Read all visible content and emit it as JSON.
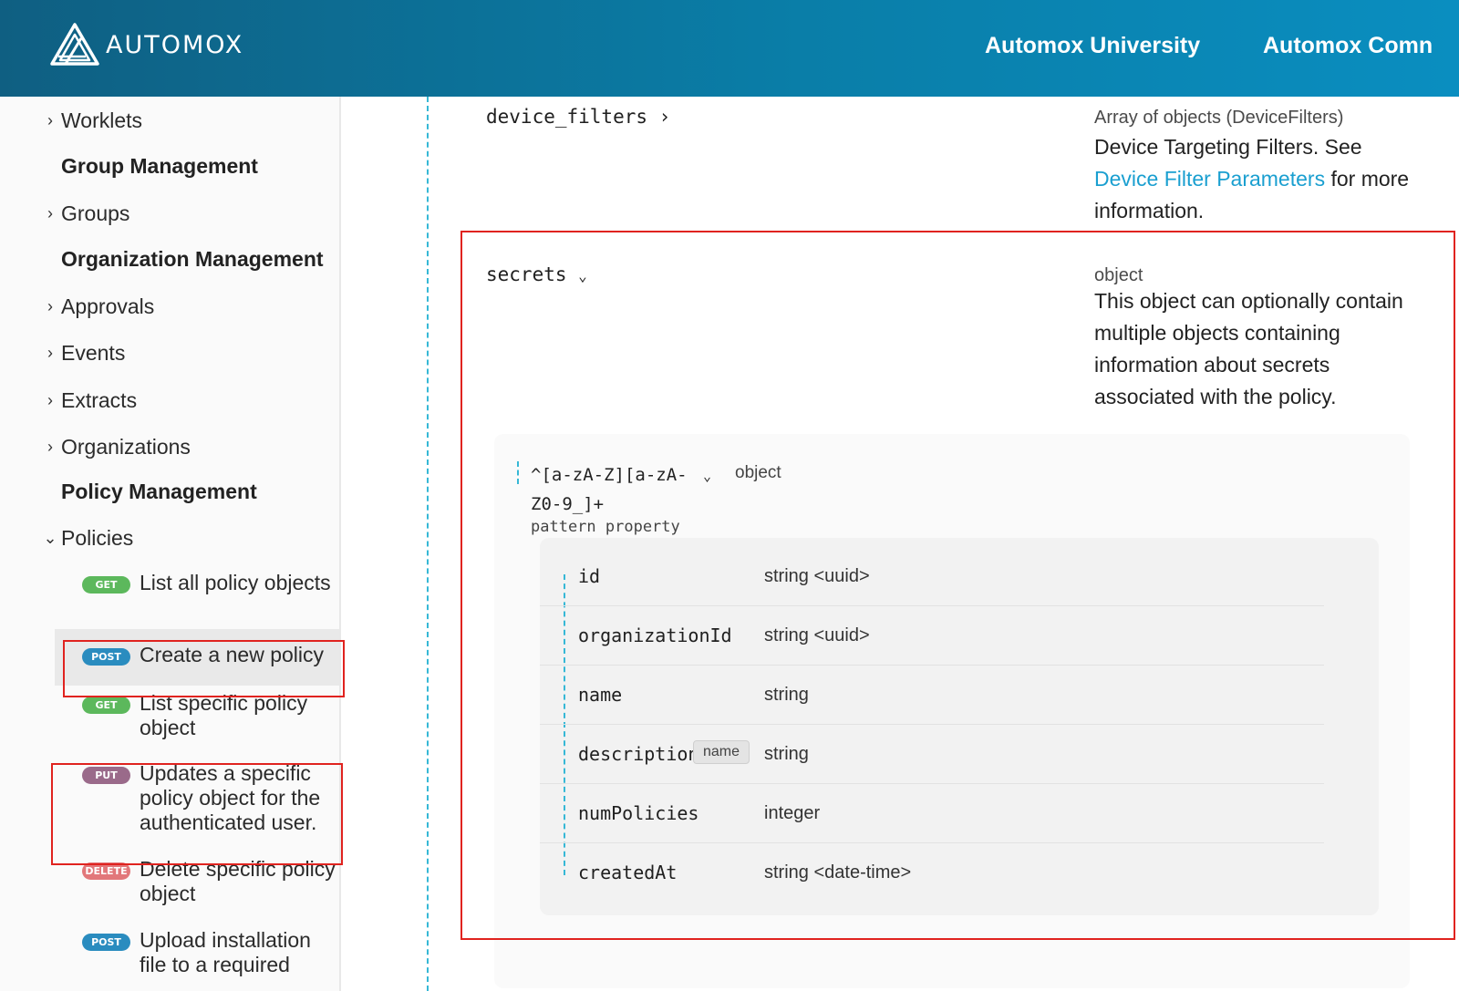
{
  "header": {
    "logo_text": "AUTOMOX",
    "nav": [
      "Automox University",
      "Automox Comn"
    ]
  },
  "sidebar": {
    "items": [
      {
        "label": "Worklets",
        "chevron": "›"
      },
      {
        "section": "Group Management"
      },
      {
        "label": "Groups",
        "chevron": "›"
      },
      {
        "section": "Organization Management"
      },
      {
        "label": "Approvals",
        "chevron": "›"
      },
      {
        "label": "Events",
        "chevron": "›"
      },
      {
        "label": "Extracts",
        "chevron": "›"
      },
      {
        "label": "Organizations",
        "chevron": "›"
      },
      {
        "section": "Policy Management"
      },
      {
        "label": "Policies",
        "chevron": "⌄"
      }
    ],
    "operations": [
      {
        "method": "GET",
        "label": "List all policy objects",
        "color": "#5cb85c"
      },
      {
        "method": "POST",
        "label": "Create a new policy",
        "color": "#2a8cbf"
      },
      {
        "method": "GET",
        "label": "List specific policy object",
        "color": "#5cb85c"
      },
      {
        "method": "PUT",
        "label": "Updates a specific policy object for the authenticated user.",
        "color": "#9a6a8a"
      },
      {
        "method": "DELETE",
        "label": "Delete specific policy object",
        "color": "#e2777a"
      },
      {
        "method": "POST",
        "label": "Upload installation file to a required",
        "color": "#2a8cbf"
      }
    ]
  },
  "main": {
    "device_filters": {
      "name": "device_filters",
      "type": "Array of objects (DeviceFilters)",
      "desc_before": "Device Targeting Filters. See",
      "link": "Device Filter Parameters",
      "desc_after": "for more information."
    },
    "secrets": {
      "name": "secrets",
      "type": "object",
      "desc": "This object can optionally contain multiple objects containing information about secrets associated with the policy."
    },
    "pattern": {
      "line1": "^[a-zA-Z][a-zA-",
      "line2": "Z0-9_]+",
      "kind": "pattern property",
      "type": "object"
    },
    "fields": [
      {
        "name": "id",
        "type": "string <uuid>"
      },
      {
        "name": "organizationId",
        "type": "string <uuid>"
      },
      {
        "name": "name",
        "type": "string"
      },
      {
        "name": "description",
        "type": "string"
      },
      {
        "name": "numPolicies",
        "type": "integer"
      },
      {
        "name": "createdAt",
        "type": "string <date-time>"
      }
    ],
    "tooltip": "name"
  }
}
